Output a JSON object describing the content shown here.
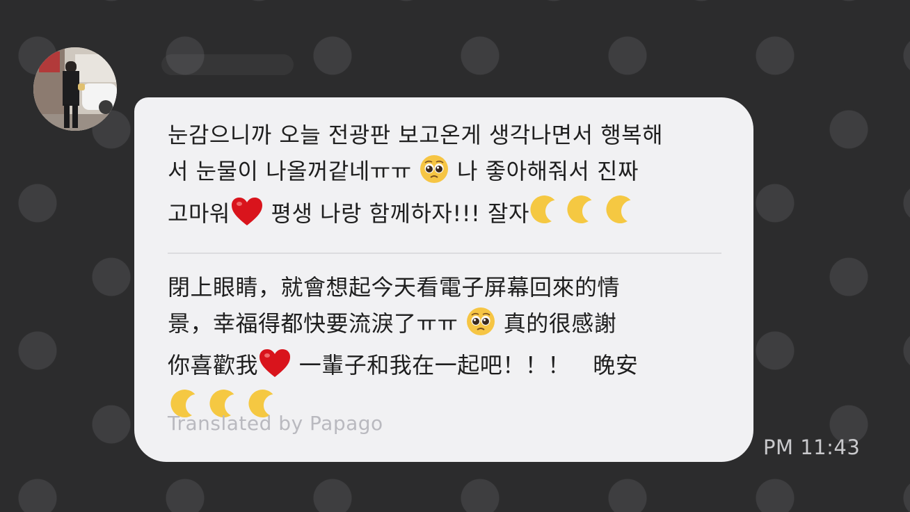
{
  "chat": {
    "time": "PM 11:43"
  },
  "message": {
    "original_lines": [
      [
        "눈감으니까 오늘 전광판 보고온게 생각나면서 행복해"
      ],
      [
        "서 눈물이 나올꺼같네ㅠㅠ ",
        "pleading-face",
        " 나 좋아해줘서 진짜"
      ],
      [
        "고마워",
        "red-heart",
        " 평생 나랑 함께하자!!! 잘자",
        "crescent-moon",
        "crescent-moon",
        "crescent-moon"
      ]
    ],
    "translated_lines": [
      [
        "閉上眼睛，就會想起今天看電子屏幕回來的情"
      ],
      [
        "景，幸福得都快要流淚了ㅠㅠ ",
        "pleading-face",
        " 真的很感謝"
      ],
      [
        "你喜歡我",
        "red-heart",
        " 一輩子和我在一起吧！！！　晚安"
      ],
      [
        "crescent-moon",
        "crescent-moon",
        "crescent-moon"
      ]
    ],
    "segments": {
      "o1": "눈감으니까 오늘 전광판 보고온게 생각나면서 행복해",
      "o2a": "서 눈물이 나올꺼같네ㅠㅠ ",
      "o2b": " 나 좋아해줘서 진짜",
      "o3a": "고마워",
      "o3b": " 평생 나랑 함께하자!!! 잘자",
      "t1": "閉上眼睛，就會想起今天看電子屏幕回來的情",
      "t2a": "景，幸福得都快要流淚了ㅠㅠ ",
      "t2b": " 真的很感謝",
      "t3a": "你喜歡我",
      "t3b": " 一輩子和我在一起吧！！！　晚安"
    },
    "translated_by": "Translated by Papago"
  },
  "icons": {
    "pleading": "pleading-face-icon",
    "heart": "red-heart-icon",
    "moon": "crescent-moon-icon"
  },
  "colors": {
    "background": "#2c2c2d",
    "bubble": "#f1f1f3",
    "text": "#1e1e1e",
    "heart": "#d9141c",
    "moon": "#f5c842"
  }
}
